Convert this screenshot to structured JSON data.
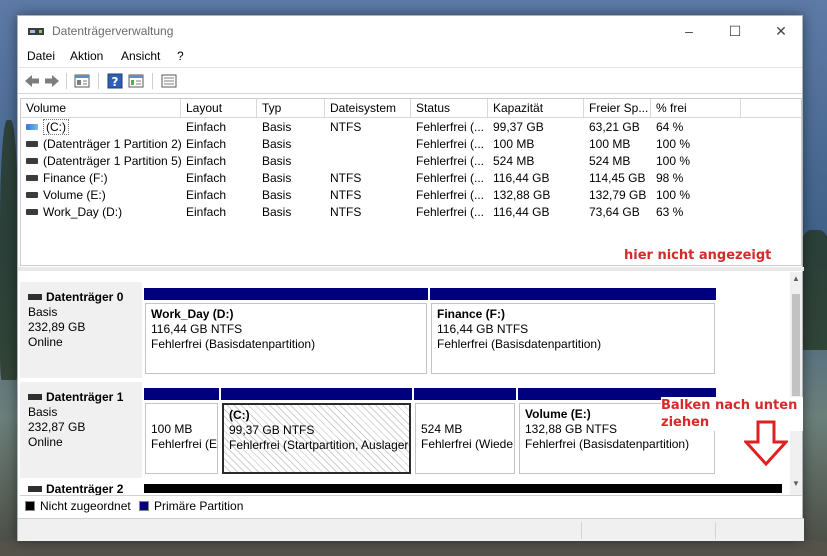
{
  "window": {
    "title": "Datenträgerverwaltung"
  },
  "menu": [
    "Datei",
    "Aktion",
    "Ansicht",
    "?"
  ],
  "list": {
    "columns": [
      "Volume",
      "Layout",
      "Typ",
      "Dateisystem",
      "Status",
      "Kapazität",
      "Freier Sp...",
      "% frei"
    ],
    "rows": [
      {
        "volume": "(C:)",
        "layout": "Einfach",
        "typ": "Basis",
        "fs": "NTFS",
        "status": "Fehlerfrei (...",
        "cap": "99,37 GB",
        "free": "63,21 GB",
        "pct": "64 %",
        "icon": "system-volume-icon"
      },
      {
        "volume": "(Datenträger 1 Partition 2)",
        "layout": "Einfach",
        "typ": "Basis",
        "fs": "",
        "status": "Fehlerfrei (...",
        "cap": "100 MB",
        "free": "100 MB",
        "pct": "100 %",
        "icon": "volume-icon"
      },
      {
        "volume": "(Datenträger 1 Partition 5)",
        "layout": "Einfach",
        "typ": "Basis",
        "fs": "",
        "status": "Fehlerfrei (...",
        "cap": "524 MB",
        "free": "524 MB",
        "pct": "100 %",
        "icon": "volume-icon"
      },
      {
        "volume": "Finance (F:)",
        "layout": "Einfach",
        "typ": "Basis",
        "fs": "NTFS",
        "status": "Fehlerfrei (...",
        "cap": "116,44 GB",
        "free": "114,45 GB",
        "pct": "98 %",
        "icon": "volume-icon"
      },
      {
        "volume": "Volume (E:)",
        "layout": "Einfach",
        "typ": "Basis",
        "fs": "NTFS",
        "status": "Fehlerfrei (...",
        "cap": "132,88 GB",
        "free": "132,79 GB",
        "pct": "100 %",
        "icon": "volume-icon"
      },
      {
        "volume": "Work_Day (D:)",
        "layout": "Einfach",
        "typ": "Basis",
        "fs": "NTFS",
        "status": "Fehlerfrei (...",
        "cap": "116,44 GB",
        "free": "73,64 GB",
        "pct": "63 %",
        "icon": "volume-icon"
      }
    ]
  },
  "annotations": {
    "not_shown": "hier nicht angezeigt",
    "drag_line1": "Balken nach unten",
    "drag_line2": "ziehen"
  },
  "disks": [
    {
      "title": "Datenträger 0",
      "type": "Basis",
      "size": "232,89 GB",
      "state": "Online",
      "partitions": [
        {
          "name": "Work_Day  (D:)",
          "size": "116,44 GB NTFS",
          "status": "Fehlerfrei (Basisdatenpartition)"
        },
        {
          "name": "Finance  (F:)",
          "size": "116,44 GB NTFS",
          "status": "Fehlerfrei (Basisdatenpartition)"
        }
      ]
    },
    {
      "title": "Datenträger 1",
      "type": "Basis",
      "size": "232,87 GB",
      "state": "Online",
      "partitions": [
        {
          "name": "",
          "size": "100 MB",
          "status": "Fehlerfrei (E"
        },
        {
          "name": "(C:)",
          "size": "99,37 GB NTFS",
          "status": "Fehlerfrei (Startpartition, Auslager"
        },
        {
          "name": "",
          "size": "524 MB",
          "status": "Fehlerfrei (Wiede"
        },
        {
          "name": "Volume  (E:)",
          "size": "132,88 GB NTFS",
          "status": "Fehlerfrei (Basisdatenpartition)"
        }
      ]
    },
    {
      "title": "Datenträger 2"
    }
  ],
  "legend": [
    {
      "label": "Nicht zugeordnet",
      "color": "#000000"
    },
    {
      "label": "Primäre Partition",
      "color": "#00007f"
    }
  ],
  "colors": {
    "primary_partition": "#00007f",
    "annotation": "#d52a2a"
  }
}
